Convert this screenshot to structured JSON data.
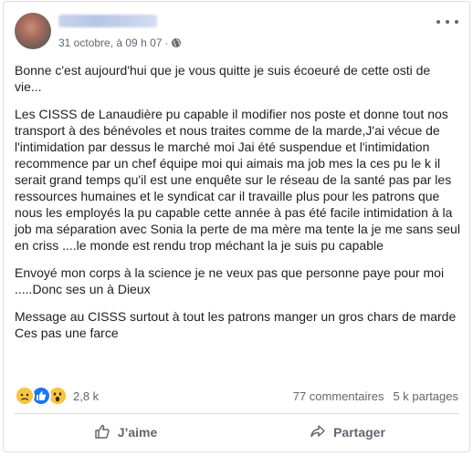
{
  "post": {
    "timestamp": "31 octobre, à 09 h 07",
    "privacy_icon": "globe-icon",
    "paragraphs": [
      "Bonne c'est aujourd'hui que je vous quitte je suis écoeuré de cette osti de vie...",
      "Les CISSS de Lanaudière pu capable il modifier nos poste et donne tout nos transport à des bénévoles et nous traites comme de la marde,J'ai vécue de l'intimidation par dessus le marché moi Jai été suspendue et l'intimidation recommence par un chef équipe moi qui aimais ma job mes la ces pu le k il serait grand temps qu'il est une enquête sur le réseau de la santé pas par les ressources humaines et le syndicat car il travaille plus pour les patrons que nous les employés la pu capable cette année à pas été facile intimidation à la job ma séparation avec Sonia la perte de ma mère ma tente la je me sans seul en criss ....le monde est rendu trop méchant la je suis pu capable",
      "Envoyé mon corps à la science je ne veux pas que personne paye pour moi .....Donc ses un à Dieux",
      "Message au CISSS surtout à tout les patrons manger un gros chars de marde\nCes pas une farce"
    ]
  },
  "stats": {
    "reactions": [
      "sad",
      "like",
      "wow"
    ],
    "reaction_count": "2,8 k",
    "comments": "77 commentaires",
    "shares": "5 k partages"
  },
  "actions": {
    "like_label": "J’aime",
    "share_label": "Partager"
  },
  "colors": {
    "facebook_blue": "#1877f2",
    "secondary_text": "#606770",
    "divider": "#dadde1"
  }
}
